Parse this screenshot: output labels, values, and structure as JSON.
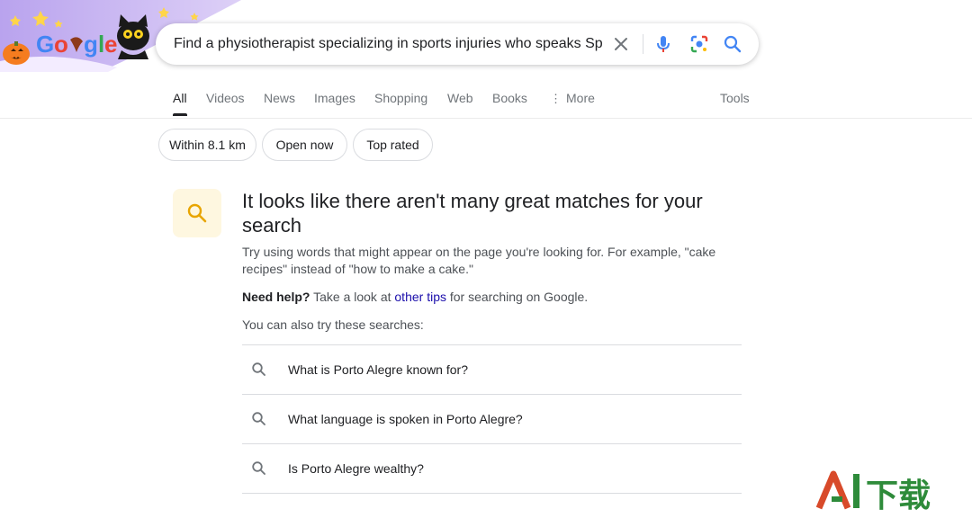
{
  "search": {
    "query": "Find a physiotherapist specializing in sports injuries who speaks Spar"
  },
  "logo": {
    "text": "Google"
  },
  "tabs": [
    {
      "label": "All",
      "active": true
    },
    {
      "label": "Videos"
    },
    {
      "label": "News"
    },
    {
      "label": "Images"
    },
    {
      "label": "Shopping"
    },
    {
      "label": "Web"
    },
    {
      "label": "Books"
    },
    {
      "label": "More"
    }
  ],
  "tools_label": "Tools",
  "chips": [
    "Within 8.1 km",
    "Open now",
    "Top rated"
  ],
  "no_results": {
    "headline": "It looks like there aren't many great matches for your search",
    "tip": "Try using words that might appear on the page you're looking for. For example, \"cake recipes\" instead of \"how to make a cake.\"",
    "help_bold": "Need help?",
    "help_pre": " Take a look at ",
    "help_link": "other tips",
    "help_post": " for searching on Google.",
    "also": "You can also try these searches:"
  },
  "suggestions": [
    "What is Porto Alegre known for?",
    "What language is spoken in Porto Alegre?",
    "Is Porto Alegre wealthy?"
  ],
  "watermark": {
    "latin": "AI",
    "cjk": "下载"
  },
  "colors": {
    "link": "#1a0dab",
    "doodle_purple": "#c9b3f0",
    "mic_blue": "#4285f4"
  }
}
